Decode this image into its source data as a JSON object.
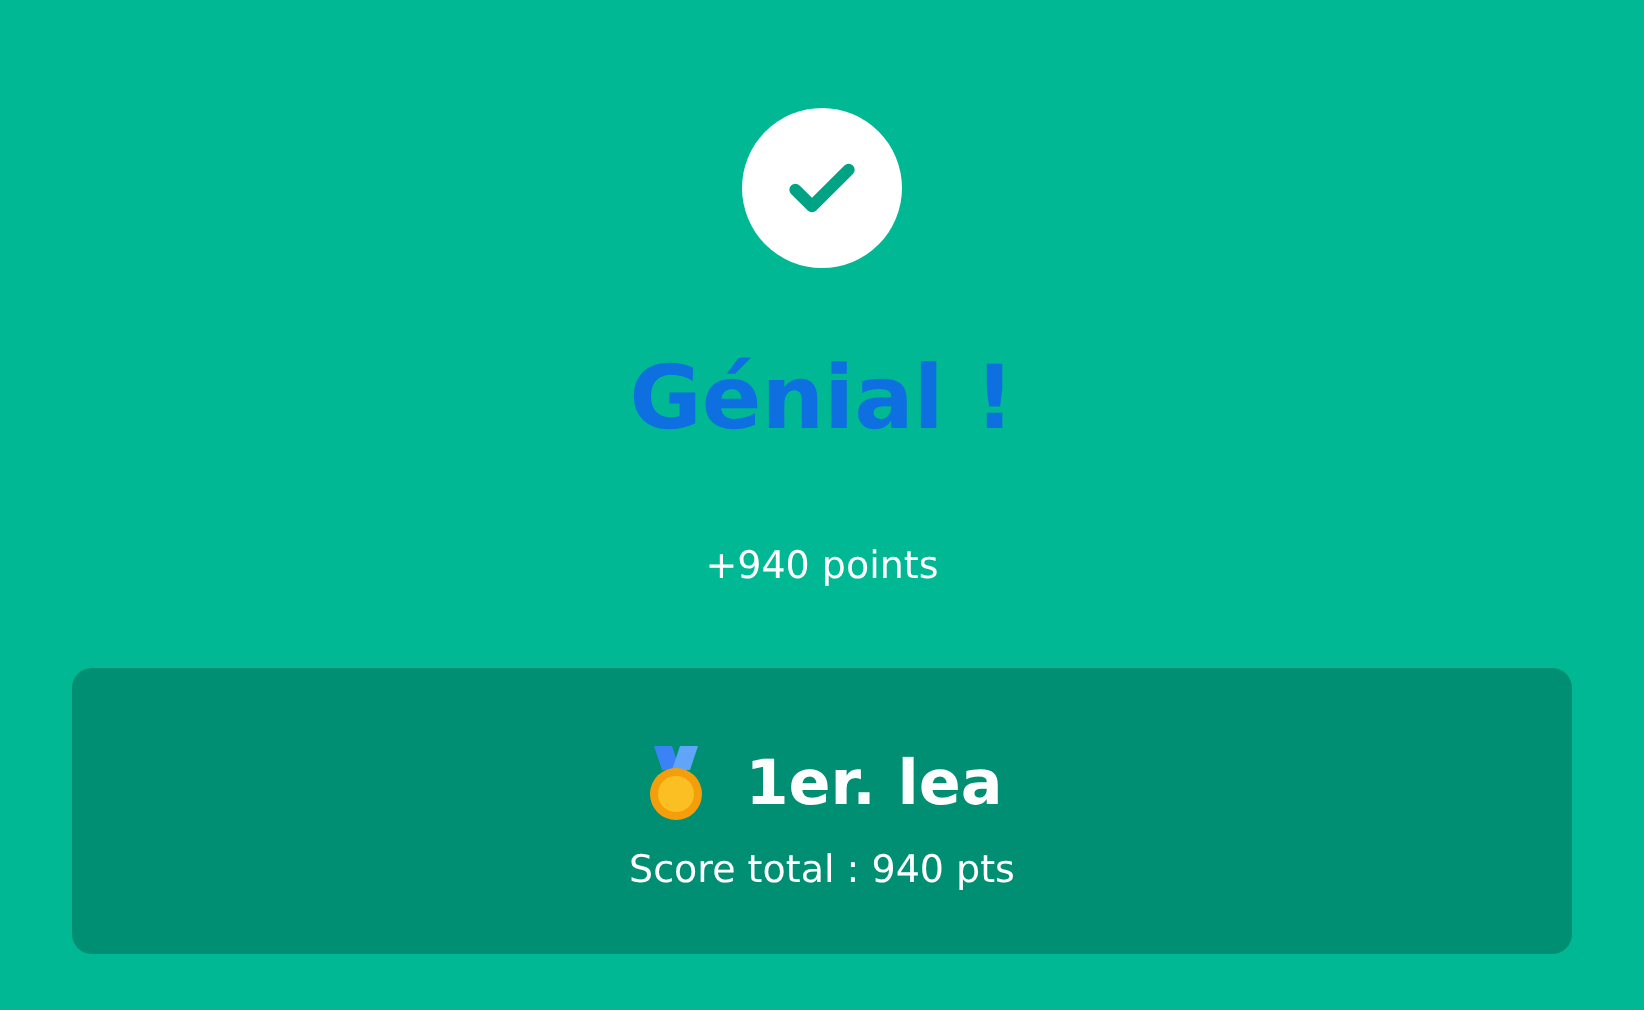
{
  "title": "Génial !",
  "points": "+940 points",
  "result": {
    "rank_name": "1er. lea",
    "total": "Score total : 940 pts"
  }
}
